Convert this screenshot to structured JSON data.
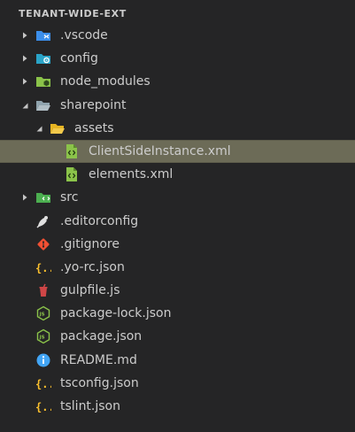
{
  "explorer": {
    "title": "TENANT-WIDE-EXT"
  },
  "items": [
    {
      "label": ".vscode",
      "name": "tree-item-vscode",
      "icon": "vscode-folder-icon",
      "twisty": "collapsed"
    },
    {
      "label": "config",
      "name": "tree-item-config",
      "icon": "config-folder-icon",
      "twisty": "collapsed"
    },
    {
      "label": "node_modules",
      "name": "tree-item-node-modules",
      "icon": "node-folder-icon",
      "twisty": "collapsed"
    },
    {
      "label": "sharepoint",
      "name": "tree-item-sharepoint",
      "icon": "folder-open-icon",
      "twisty": "expanded"
    },
    {
      "label": "assets",
      "name": "tree-item-assets",
      "icon": "folder-open-icon",
      "twisty": "expanded"
    },
    {
      "label": "ClientSideInstance.xml",
      "name": "tree-item-clientsideinstance-xml",
      "icon": "xml-file-icon",
      "selected": true
    },
    {
      "label": "elements.xml",
      "name": "tree-item-elements-xml",
      "icon": "xml-file-icon"
    },
    {
      "label": "src",
      "name": "tree-item-src",
      "icon": "src-folder-icon",
      "twisty": "collapsed"
    },
    {
      "label": ".editorconfig",
      "name": "tree-item-editorconfig",
      "icon": "editorconfig-icon"
    },
    {
      "label": ".gitignore",
      "name": "tree-item-gitignore",
      "icon": "git-icon"
    },
    {
      "label": ".yo-rc.json",
      "name": "tree-item-yo-rc-json",
      "icon": "json-braces-icon"
    },
    {
      "label": "gulpfile.js",
      "name": "tree-item-gulpfile-js",
      "icon": "gulp-icon"
    },
    {
      "label": "package-lock.json",
      "name": "tree-item-package-lock-json",
      "icon": "nodejs-icon"
    },
    {
      "label": "package.json",
      "name": "tree-item-package-json",
      "icon": "nodejs-icon"
    },
    {
      "label": "README.md",
      "name": "tree-item-readme-md",
      "icon": "info-icon"
    },
    {
      "label": "tsconfig.json",
      "name": "tree-item-tsconfig-json",
      "icon": "json-braces-icon"
    },
    {
      "label": "tslint.json",
      "name": "tree-item-tslint-json",
      "icon": "json-braces-icon"
    }
  ],
  "colors": {
    "background": "#252526",
    "selection": "#6c6b57",
    "text": "#cccccc",
    "twisty": "#c5c5c5",
    "vscode_blue": "#3b8eea",
    "folder_teal": "#2aa4c8",
    "node_green": "#8bc34a",
    "folder_grey": "#90a4ae",
    "folder_yellow": "#e6b422",
    "xml_green": "#8bc34a",
    "src_green": "#4caf50",
    "git_orange": "#f05033",
    "json_yellow": "#fbc02d",
    "gulp_red": "#cf4647",
    "info_blue": "#42a5f5"
  }
}
